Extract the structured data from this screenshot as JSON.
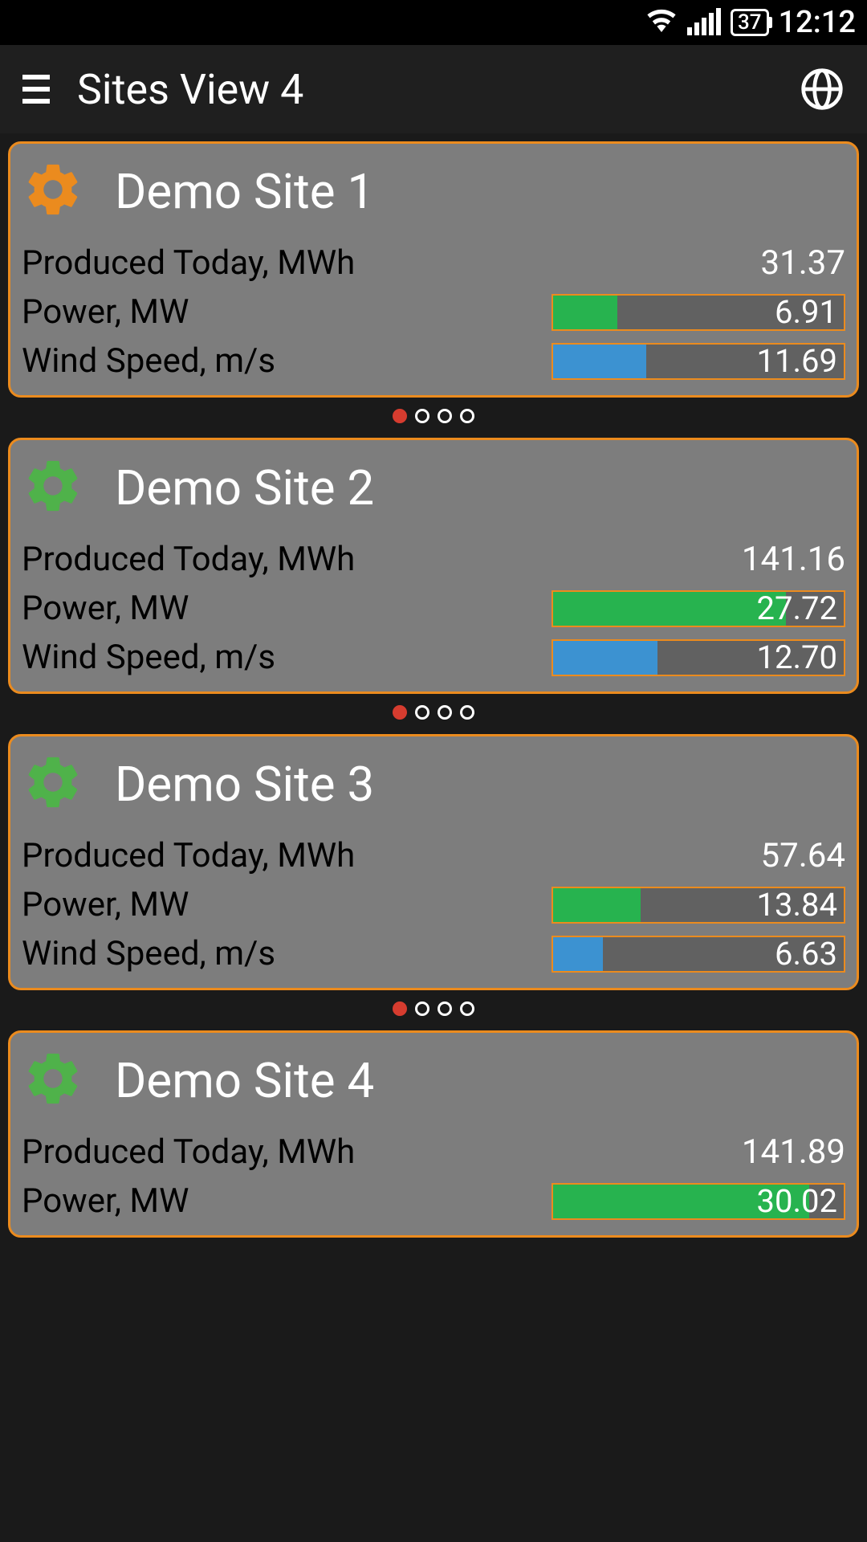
{
  "status": {
    "battery": "37",
    "time": "12:12"
  },
  "header": {
    "title": "Sites View 4"
  },
  "labels": {
    "produced": "Produced Today, MWh",
    "power": "Power, MW",
    "wind": "Wind Speed, m/s"
  },
  "colors": {
    "accent": "#eb8b1e",
    "gear_orange": "#eb8b1e",
    "gear_green": "#4fb24a",
    "bar_power": "#27b34f",
    "bar_wind": "#3c92d1"
  },
  "pager": {
    "count": 4,
    "active": 0
  },
  "sites": [
    {
      "name": "Demo Site 1",
      "gear_color": "#eb8b1e",
      "produced": "31.37",
      "power": {
        "value": "6.91",
        "pct": 22
      },
      "wind": {
        "value": "11.69",
        "pct": 32
      }
    },
    {
      "name": "Demo Site 2",
      "gear_color": "#4fb24a",
      "produced": "141.16",
      "power": {
        "value": "27.72",
        "pct": 80
      },
      "wind": {
        "value": "12.70",
        "pct": 36
      }
    },
    {
      "name": "Demo Site 3",
      "gear_color": "#4fb24a",
      "produced": "57.64",
      "power": {
        "value": "13.84",
        "pct": 30
      },
      "wind": {
        "value": "6.63",
        "pct": 17
      }
    },
    {
      "name": "Demo Site 4",
      "gear_color": "#4fb24a",
      "produced": "141.89",
      "power": {
        "value": "30.02",
        "pct": 88
      },
      "wind": {
        "value": "",
        "pct": 0
      }
    }
  ]
}
